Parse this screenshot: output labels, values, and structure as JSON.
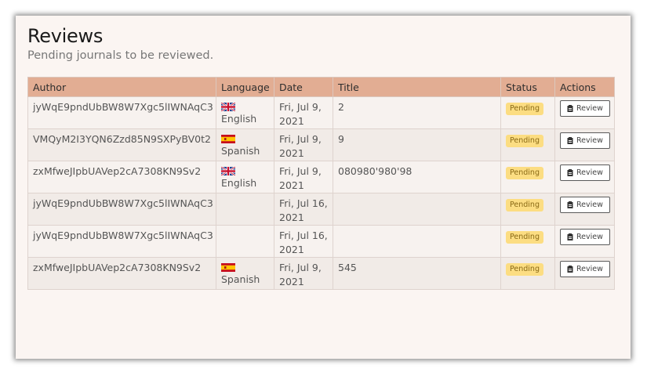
{
  "page": {
    "title": "Reviews",
    "subtitle": "Pending journals to be reviewed."
  },
  "table": {
    "columns": [
      "Author",
      "Language",
      "Date",
      "Title",
      "Status",
      "Actions"
    ],
    "rows": [
      {
        "author": "jyWqE9pndUbBW8W7Xgc5lIWNAqC3",
        "flag": "uk-flag-icon",
        "language": "English",
        "date_line1": "Fri, Jul 9,",
        "date_line2": "2021",
        "title": "2",
        "status": "Pending",
        "action": "Review"
      },
      {
        "author": "VMQyM2I3YQN6Zzd85N9SXPyBV0t2",
        "flag": "spain-flag-icon",
        "language": "Spanish",
        "date_line1": "Fri, Jul 9,",
        "date_line2": "2021",
        "title": "9",
        "status": "Pending",
        "action": "Review"
      },
      {
        "author": "zxMfweJIpbUAVep2cA7308KN9Sv2",
        "flag": "uk-flag-icon",
        "language": "English",
        "date_line1": "Fri, Jul 9,",
        "date_line2": "2021",
        "title": "080980'980'98",
        "status": "Pending",
        "action": "Review"
      },
      {
        "author": "jyWqE9pndUbBW8W7Xgc5lIWNAqC3",
        "flag": "",
        "language": "",
        "date_line1": "Fri, Jul 16,",
        "date_line2": "2021",
        "title": "",
        "status": "Pending",
        "action": "Review"
      },
      {
        "author": "jyWqE9pndUbBW8W7Xgc5lIWNAqC3",
        "flag": "",
        "language": "",
        "date_line1": "Fri, Jul 16,",
        "date_line2": "2021",
        "title": "",
        "status": "Pending",
        "action": "Review"
      },
      {
        "author": "zxMfweJIpbUAVep2cA7308KN9Sv2",
        "flag": "spain-flag-icon",
        "language": "Spanish",
        "date_line1": "Fri, Jul 9,",
        "date_line2": "2021",
        "title": "545",
        "status": "Pending",
        "action": "Review"
      }
    ]
  },
  "colors": {
    "header_bg": "#e2ad93",
    "card_bg": "#fbf5f2",
    "badge_bg": "#fcdd82",
    "badge_text": "#8a6a16"
  },
  "icons": {
    "review_button": "clipboard-icon"
  }
}
